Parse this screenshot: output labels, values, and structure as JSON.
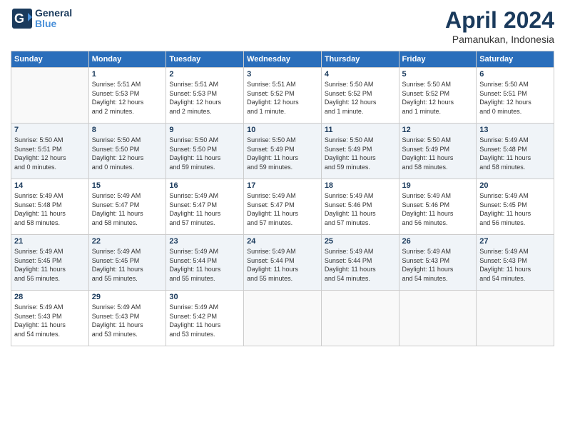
{
  "header": {
    "logo": {
      "general": "General",
      "blue": "Blue"
    },
    "title": "April 2024",
    "location": "Pamanukan, Indonesia"
  },
  "weekdays": [
    "Sunday",
    "Monday",
    "Tuesday",
    "Wednesday",
    "Thursday",
    "Friday",
    "Saturday"
  ],
  "weeks": [
    [
      {
        "day": "",
        "info": ""
      },
      {
        "day": "1",
        "info": "Sunrise: 5:51 AM\nSunset: 5:53 PM\nDaylight: 12 hours\nand 2 minutes."
      },
      {
        "day": "2",
        "info": "Sunrise: 5:51 AM\nSunset: 5:53 PM\nDaylight: 12 hours\nand 2 minutes."
      },
      {
        "day": "3",
        "info": "Sunrise: 5:51 AM\nSunset: 5:52 PM\nDaylight: 12 hours\nand 1 minute."
      },
      {
        "day": "4",
        "info": "Sunrise: 5:50 AM\nSunset: 5:52 PM\nDaylight: 12 hours\nand 1 minute."
      },
      {
        "day": "5",
        "info": "Sunrise: 5:50 AM\nSunset: 5:52 PM\nDaylight: 12 hours\nand 1 minute."
      },
      {
        "day": "6",
        "info": "Sunrise: 5:50 AM\nSunset: 5:51 PM\nDaylight: 12 hours\nand 0 minutes."
      }
    ],
    [
      {
        "day": "7",
        "info": "Sunrise: 5:50 AM\nSunset: 5:51 PM\nDaylight: 12 hours\nand 0 minutes."
      },
      {
        "day": "8",
        "info": "Sunrise: 5:50 AM\nSunset: 5:50 PM\nDaylight: 12 hours\nand 0 minutes."
      },
      {
        "day": "9",
        "info": "Sunrise: 5:50 AM\nSunset: 5:50 PM\nDaylight: 11 hours\nand 59 minutes."
      },
      {
        "day": "10",
        "info": "Sunrise: 5:50 AM\nSunset: 5:49 PM\nDaylight: 11 hours\nand 59 minutes."
      },
      {
        "day": "11",
        "info": "Sunrise: 5:50 AM\nSunset: 5:49 PM\nDaylight: 11 hours\nand 59 minutes."
      },
      {
        "day": "12",
        "info": "Sunrise: 5:50 AM\nSunset: 5:49 PM\nDaylight: 11 hours\nand 58 minutes."
      },
      {
        "day": "13",
        "info": "Sunrise: 5:49 AM\nSunset: 5:48 PM\nDaylight: 11 hours\nand 58 minutes."
      }
    ],
    [
      {
        "day": "14",
        "info": "Sunrise: 5:49 AM\nSunset: 5:48 PM\nDaylight: 11 hours\nand 58 minutes."
      },
      {
        "day": "15",
        "info": "Sunrise: 5:49 AM\nSunset: 5:47 PM\nDaylight: 11 hours\nand 58 minutes."
      },
      {
        "day": "16",
        "info": "Sunrise: 5:49 AM\nSunset: 5:47 PM\nDaylight: 11 hours\nand 57 minutes."
      },
      {
        "day": "17",
        "info": "Sunrise: 5:49 AM\nSunset: 5:47 PM\nDaylight: 11 hours\nand 57 minutes."
      },
      {
        "day": "18",
        "info": "Sunrise: 5:49 AM\nSunset: 5:46 PM\nDaylight: 11 hours\nand 57 minutes."
      },
      {
        "day": "19",
        "info": "Sunrise: 5:49 AM\nSunset: 5:46 PM\nDaylight: 11 hours\nand 56 minutes."
      },
      {
        "day": "20",
        "info": "Sunrise: 5:49 AM\nSunset: 5:45 PM\nDaylight: 11 hours\nand 56 minutes."
      }
    ],
    [
      {
        "day": "21",
        "info": "Sunrise: 5:49 AM\nSunset: 5:45 PM\nDaylight: 11 hours\nand 56 minutes."
      },
      {
        "day": "22",
        "info": "Sunrise: 5:49 AM\nSunset: 5:45 PM\nDaylight: 11 hours\nand 55 minutes."
      },
      {
        "day": "23",
        "info": "Sunrise: 5:49 AM\nSunset: 5:44 PM\nDaylight: 11 hours\nand 55 minutes."
      },
      {
        "day": "24",
        "info": "Sunrise: 5:49 AM\nSunset: 5:44 PM\nDaylight: 11 hours\nand 55 minutes."
      },
      {
        "day": "25",
        "info": "Sunrise: 5:49 AM\nSunset: 5:44 PM\nDaylight: 11 hours\nand 54 minutes."
      },
      {
        "day": "26",
        "info": "Sunrise: 5:49 AM\nSunset: 5:43 PM\nDaylight: 11 hours\nand 54 minutes."
      },
      {
        "day": "27",
        "info": "Sunrise: 5:49 AM\nSunset: 5:43 PM\nDaylight: 11 hours\nand 54 minutes."
      }
    ],
    [
      {
        "day": "28",
        "info": "Sunrise: 5:49 AM\nSunset: 5:43 PM\nDaylight: 11 hours\nand 54 minutes."
      },
      {
        "day": "29",
        "info": "Sunrise: 5:49 AM\nSunset: 5:43 PM\nDaylight: 11 hours\nand 53 minutes."
      },
      {
        "day": "30",
        "info": "Sunrise: 5:49 AM\nSunset: 5:42 PM\nDaylight: 11 hours\nand 53 minutes."
      },
      {
        "day": "",
        "info": ""
      },
      {
        "day": "",
        "info": ""
      },
      {
        "day": "",
        "info": ""
      },
      {
        "day": "",
        "info": ""
      }
    ]
  ]
}
